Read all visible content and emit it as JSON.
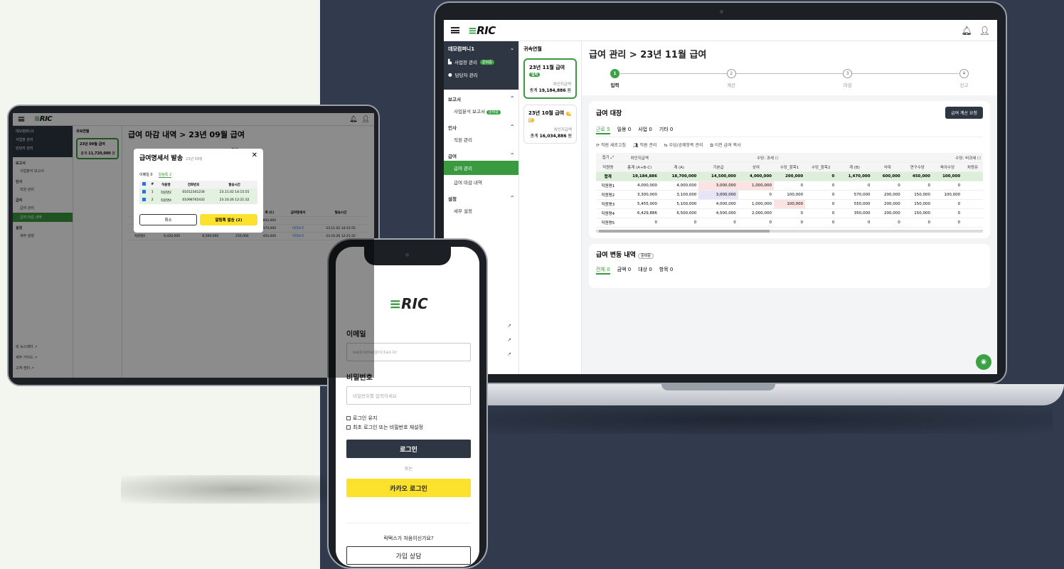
{
  "brand": {
    "logo": "RIC"
  },
  "laptop": {
    "company": "데모컴퍼니1",
    "sidebar_top": [
      {
        "label": "사업장 관리",
        "tag": "준비중"
      },
      {
        "label": "담당자 관리",
        "tag": ""
      }
    ],
    "groups": [
      {
        "label": "보고서",
        "items": [
          {
            "label": "사업분석 보고서",
            "tag": "준비중"
          }
        ]
      },
      {
        "label": "인사",
        "items": [
          {
            "label": "직원 관리"
          }
        ]
      },
      {
        "label": "급여",
        "items": [
          {
            "label": "급여 관리",
            "active": true
          },
          {
            "label": "급여 마감 내역"
          }
        ]
      },
      {
        "label": "설정",
        "items": [
          {
            "label": "세무 설정"
          }
        ]
      }
    ],
    "col2_title": "귀속연월",
    "months": [
      {
        "title": "23년 11월 급여",
        "tag": "입력",
        "sub": "차인지급액",
        "value_label": "총계",
        "value": "19,184,886",
        "unit": "원"
      },
      {
        "title": "23년 10월 급여",
        "tag": "계산",
        "sub": "차인지급액",
        "value_label": "총계",
        "value": "16,034,886",
        "unit": "원"
      }
    ],
    "page_title": "급여 관리 > 23년 11월 급여",
    "steps": [
      {
        "num": "1",
        "label": "입력"
      },
      {
        "num": "2",
        "label": "계산"
      },
      {
        "num": "3",
        "label": "마감"
      },
      {
        "num": "4",
        "label": "신고"
      }
    ],
    "ledger": {
      "title": "급여 대장",
      "button": "급여 계산 요청",
      "tabs": [
        {
          "label": "근로",
          "count": "5"
        },
        {
          "label": "일용",
          "count": "0"
        },
        {
          "label": "사업",
          "count": "0"
        },
        {
          "label": "기타",
          "count": "0"
        }
      ],
      "tools": [
        "직원 새로고침",
        "직원 관리",
        "수당/공제항목 관리",
        "이전 급여 복사"
      ],
      "group_row": [
        "접기",
        "차인지급액",
        "수당: 과세",
        "수당: 비과세"
      ],
      "headers": [
        "직원명",
        "총계 (A+B-C)",
        "계 (A)",
        "기본급",
        "상여",
        "수당_항목1",
        "수당_항목2",
        "계 (B)",
        "식대",
        "연구수당",
        "육아수당",
        "차량유"
      ],
      "rows": [
        [
          "합계",
          "19,184,886",
          "18,700,000",
          "14,500,000",
          "4,000,000",
          "200,000",
          "0",
          "1,470,000",
          "600,000",
          "450,000",
          "100,000",
          ""
        ],
        [
          "직원명1",
          "4,000,000",
          "4,000,000",
          "3,000,000",
          "1,000,000",
          "0",
          "0",
          "0",
          "0",
          "0",
          "0",
          ""
        ],
        [
          "직원명2",
          "3,300,000",
          "3,100,000",
          "3,000,000",
          "0",
          "100,000",
          "0",
          "570,000",
          "200,000",
          "150,000",
          "100,000",
          ""
        ],
        [
          "직원명3",
          "5,455,000",
          "5,100,000",
          "4,000,000",
          "1,000,000",
          "100,000",
          "0",
          "550,000",
          "200,000",
          "150,000",
          "0",
          ""
        ],
        [
          "직원명4",
          "6,429,886",
          "6,500,000",
          "4,500,000",
          "2,000,000",
          "0",
          "0",
          "350,000",
          "200,000",
          "150,000",
          "0",
          ""
        ],
        [
          "직원명5",
          "0",
          "0",
          "0",
          "0",
          "0",
          "0",
          "0",
          "0",
          "0",
          "0",
          ""
        ]
      ]
    },
    "changes": {
      "title": "급여 변동 내역",
      "tag": "준비중",
      "tabs": [
        {
          "label": "전체",
          "count": "0"
        },
        {
          "label": "금액",
          "count": "0"
        },
        {
          "label": "대상",
          "count": "0"
        },
        {
          "label": "항목",
          "count": "0"
        }
      ]
    }
  },
  "tablet": {
    "company": "데모컴퍼니1",
    "side_items": [
      "사업장 관리",
      "담당자 관리"
    ],
    "groups": [
      {
        "label": "보고서",
        "items": [
          "사업분석 보고서"
        ]
      },
      {
        "label": "인사",
        "items": [
          "직원 관리"
        ]
      },
      {
        "label": "급여",
        "items": [
          "급여 관리",
          "급여 마감 내역"
        ]
      },
      {
        "label": "설정",
        "items": [
          "세무 설정"
        ]
      }
    ],
    "links": [
      "릭 뉴스레터",
      "세무 가이드",
      "고객 센터"
    ],
    "col2_title": "귀속연월",
    "month_title": "23년 09월 급여",
    "month_value_label": "총계",
    "month_value": "11,720,000",
    "month_unit": "원",
    "page_title": "급여 마감 내역 > 23년 09월 급여",
    "step_label": "마감",
    "table_headers": [
      "직원명",
      "총계 (A+B-C)",
      "계 (A)",
      "계 (B)",
      "계 (C)",
      "급여명세서",
      "발송시간"
    ],
    "table_rows": [
      [
        "합계",
        "11,720,000",
        "11,500,000",
        "820,000",
        "850,000",
        "",
        ""
      ],
      [
        "직원명2",
        "5,300,000",
        "5,100,000",
        "570,000",
        "370,000",
        "미리보기",
        "23.11.02 14:15:55"
      ],
      [
        "직원명4",
        "6,420,000",
        "6,500,000",
        "250,000",
        "450,000",
        "미리보기",
        "23.10.26 12:21:32"
      ]
    ],
    "modal": {
      "title": "급여명세서 발송",
      "subtitle": "23년 09월",
      "tabs": [
        {
          "label": "이메일",
          "count": "0"
        },
        {
          "label": "알림톡",
          "count": "2"
        }
      ],
      "headers": [
        "#",
        "직원명",
        "전화번호",
        "발송시간"
      ],
      "rows": [
        [
          "1",
          "직원명2",
          "01012341234",
          "23.11.02 14:15:55"
        ],
        [
          "2",
          "직원명4",
          "01098765432",
          "23.10.26 12:21:32"
        ]
      ],
      "cancel": "취소",
      "send": "알림톡 발송 (2)"
    }
  },
  "phone": {
    "email_label": "이메일",
    "email_placeholder": "welcome@rictax.kr",
    "password_label": "비밀번호",
    "password_placeholder": "비밀번호를 입력하세요",
    "keep_login": "로그인 유지",
    "reset_password": "최초 로그인 또는 비밀번호 재설정",
    "login": "로그인",
    "or": "또는",
    "kakao_login": "카카오 로그인",
    "question": "릭택스가 처음이신가요?",
    "join": "가입 상담"
  }
}
